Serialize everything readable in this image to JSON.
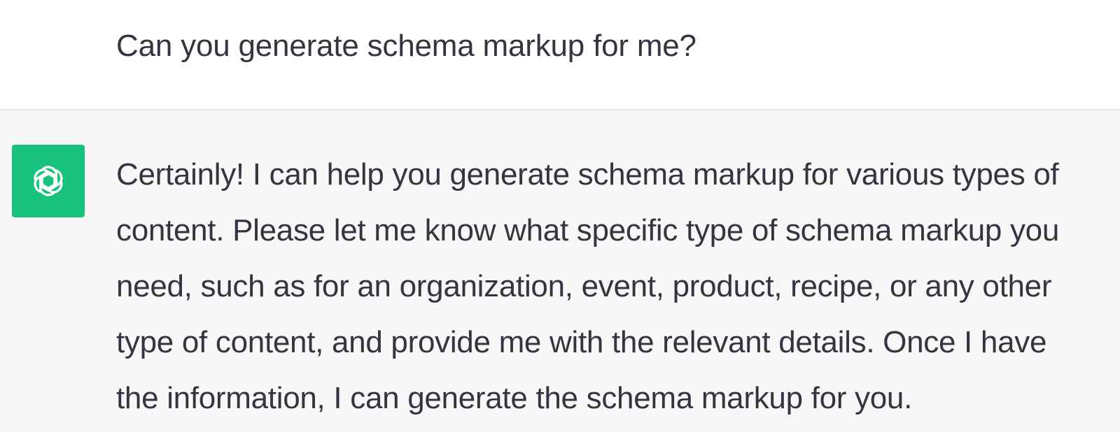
{
  "conversation": {
    "user_message": "Can you generate schema markup for me?",
    "assistant_message_lines": [
      "Certainly! I can help you generate schema markup for various types of",
      "content. Please let me know what specific type of schema markup you",
      "need, such as for an organization, event, product, recipe, or any other",
      "type of content, and provide me with the relevant details. Once I have",
      "the information, I can generate the schema markup for you."
    ]
  },
  "avatar": {
    "icon": "openai-logo-icon",
    "background_color": "#19c37d"
  },
  "colors": {
    "text": "#343541",
    "user_bg": "#ffffff",
    "assistant_bg": "#f7f7f8",
    "divider": "#e5e5e5"
  }
}
